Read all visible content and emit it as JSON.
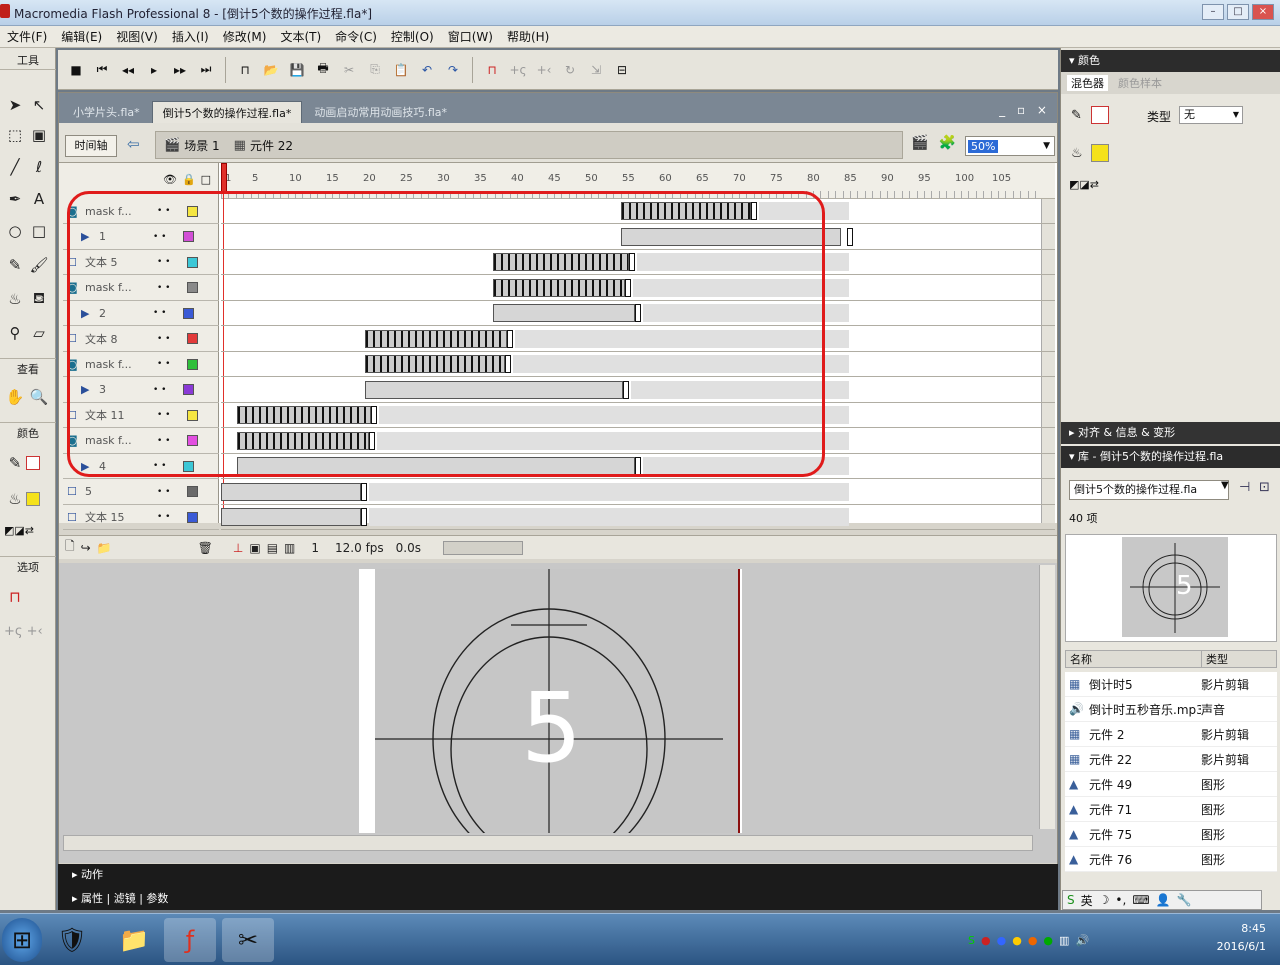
{
  "window": {
    "title": "Macromedia Flash Professional 8 - [倒计5个数的操作过程.fla*]"
  },
  "menu": [
    "文件(F)",
    "编辑(E)",
    "视图(V)",
    "插入(I)",
    "修改(M)",
    "文本(T)",
    "命令(C)",
    "控制(O)",
    "窗口(W)",
    "帮助(H)"
  ],
  "toolbox": {
    "title": "工具",
    "view_label": "查看",
    "colors_label": "颜色",
    "options_label": "选项"
  },
  "doc_tabs": [
    "小学片头.fla*",
    "倒计5个数的操作过程.fla*",
    "动画启动常用动画技巧.fla*"
  ],
  "edit_bar": {
    "timeline_label": "时间轴",
    "scene": "场景 1",
    "symbol": "元件 22",
    "zoom": "50%"
  },
  "timeline": {
    "ruler_marks": [
      "1",
      "5",
      "10",
      "15",
      "20",
      "25",
      "30",
      "35",
      "40",
      "45",
      "50",
      "55",
      "60",
      "65",
      "70",
      "75",
      "80",
      "85",
      "90",
      "95",
      "100",
      "105"
    ],
    "layers": [
      {
        "name": "mask f...",
        "type": "mask",
        "color": "#f5e642"
      },
      {
        "name": "1",
        "type": "masked",
        "color": "#d24fd6"
      },
      {
        "name": "文本 5",
        "type": "normal",
        "color": "#3cc7d6"
      },
      {
        "name": "mask f...",
        "type": "mask",
        "color": "#8a8a8a"
      },
      {
        "name": "2",
        "type": "masked",
        "color": "#3a5ad6"
      },
      {
        "name": "文本 8",
        "type": "normal",
        "color": "#e23a3a"
      },
      {
        "name": "mask f...",
        "type": "mask",
        "color": "#2fbf3a"
      },
      {
        "name": "3",
        "type": "masked",
        "color": "#8a3ad6"
      },
      {
        "name": "文本 11",
        "type": "normal",
        "color": "#f5e642"
      },
      {
        "name": "mask f...",
        "type": "mask",
        "color": "#e24fe0"
      },
      {
        "name": "4",
        "type": "masked",
        "color": "#3cc7d6"
      },
      {
        "name": "5",
        "type": "normal",
        "color": "#6a6a6a"
      },
      {
        "name": "文本 15",
        "type": "normal",
        "color": "#3a5ad6"
      }
    ],
    "footer": {
      "frame": "1",
      "fps": "12.0 fps",
      "time": "0.0s"
    }
  },
  "stage": {
    "digit": "5"
  },
  "color_panel": {
    "title": "颜色",
    "tab_mixer": "混色器",
    "tab_swatches": "颜色样本",
    "type_label": "类型",
    "type_value": "无"
  },
  "align_panel": {
    "title": "对齐 & 信息 & 变形"
  },
  "library": {
    "title": "库 - 倒计5个数的操作过程.fla",
    "selected_doc": "倒计5个数的操作过程.fla",
    "count": "40 项",
    "col_name": "名称",
    "col_type": "类型",
    "items": [
      {
        "name": "倒计时5",
        "type": "影片剪辑",
        "icon": "movie-clip-icon"
      },
      {
        "name": "倒计时五秒音乐.mp3",
        "type": "声音",
        "icon": "sound-icon"
      },
      {
        "name": "元件 2",
        "type": "影片剪辑",
        "icon": "movie-clip-icon"
      },
      {
        "name": "元件 22",
        "type": "影片剪辑",
        "icon": "movie-clip-icon"
      },
      {
        "name": "元件 49",
        "type": "图形",
        "icon": "graphic-icon"
      },
      {
        "name": "元件 71",
        "type": "图形",
        "icon": "graphic-icon"
      },
      {
        "name": "元件 75",
        "type": "图形",
        "icon": "graphic-icon"
      },
      {
        "name": "元件 76",
        "type": "图形",
        "icon": "graphic-icon"
      }
    ]
  },
  "bottom_panels": {
    "actions": "动作",
    "props_tabs": "属性 | 滤镜 | 参数"
  },
  "taskbar": {
    "time": "8:45",
    "date": "2016/6/1",
    "ime": "英"
  }
}
